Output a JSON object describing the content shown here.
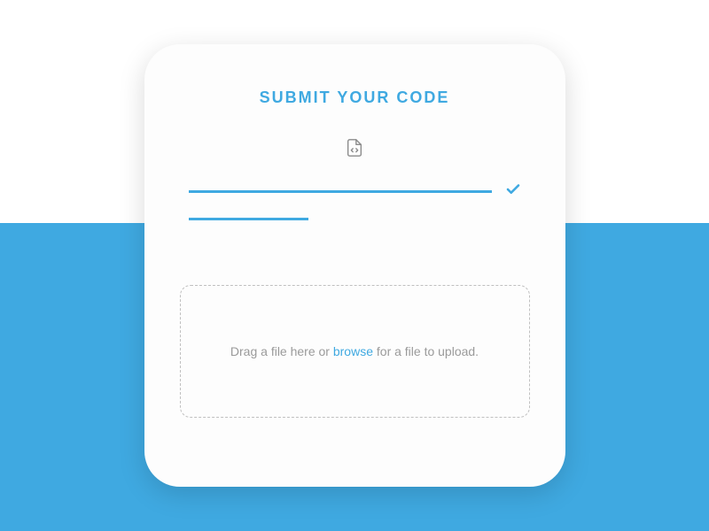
{
  "title": "SUBMIT YOUR CODE",
  "dropzone": {
    "prefix": "Drag a file here or ",
    "browse": "browse",
    "suffix": " for a file to upload."
  },
  "colors": {
    "accent": "#3fa9e1",
    "text_muted": "#9a9a9a",
    "border": "#c0c0c0"
  }
}
